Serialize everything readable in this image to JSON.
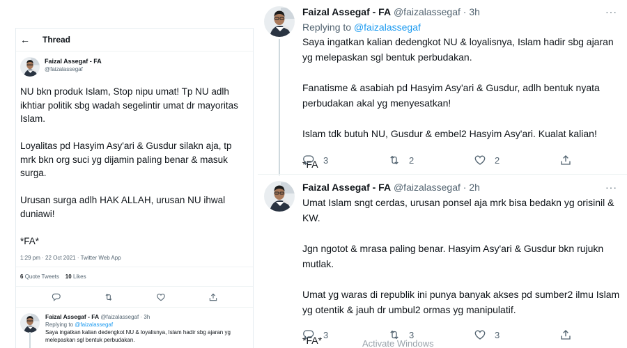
{
  "thread_view": {
    "title": "Thread",
    "main_tweet": {
      "name": "Faizal Assegaf - FA",
      "handle": "@faizalassegaf",
      "paragraphs": [
        "NU bkn produk Islam, Stop nipu umat! Tp NU adlh ikhtiar politik sbg wadah segelintir umat dr mayoritas Islam.",
        "Loyalitas pd Hasyim Asy'ari & Gusdur silakn aja, tp mrk bkn org suci yg dijamin paling benar & masuk surga.",
        "Urusan surga adlh HAK ALLAH, urusan NU ihwal duniawi!",
        "*FA*"
      ],
      "meta": "1:29 pm · 22 Oct 2021 · Twitter Web App",
      "quote_count": "6",
      "quote_label": "Quote Tweets",
      "like_count": "10",
      "like_label": "Likes"
    },
    "reply": {
      "name": "Faizal Assegaf - FA",
      "handle_time": "@faizalassegaf · 3h",
      "replying_prefix": "Replying to",
      "replying_handle": "@faizalassegaf",
      "text": "Saya ingatkan kalian dedengkot NU & loyalisnya, Islam hadir sbg ajaran yg melepaskan sgl bentuk perbudakan."
    }
  },
  "tweets": [
    {
      "name": "Faizal Assegaf - FA",
      "meta": "@faizalassegaf · 3h",
      "replying_prefix": "Replying to",
      "replying_handle": "@faizalassegaf",
      "paragraphs": [
        "Saya ingatkan kalian dedengkot NU & loyalisnya, Islam hadir sbg ajaran yg melepaskan sgl bentuk perbudakan.",
        "Fanatisme & asabiah pd Hasyim Asy'ari & Gusdur, adlh bentuk nyata perbudakan akal yg menyesatkan!",
        "Islam tdk butuh NU, Gusdur & embel2 Hasyim Asy'ari. Kualat kalian!",
        "*FA"
      ],
      "replies": "3",
      "retweets": "2",
      "likes": "2"
    },
    {
      "name": "Faizal Assegaf - FA",
      "meta": "@faizalassegaf · 2h",
      "paragraphs": [
        "Umat Islam sngt cerdas, urusan ponsel aja mrk bisa bedakn yg orisinil & KW.",
        "Jgn ngotot & mrasa paling benar. Hasyim Asy'ari & Gusdur bkn rujukn mutlak.",
        "Umat yg waras di republik ini punya banyak akses pd sumber2 ilmu Islam yg otentik & jauh dr umbul2 ormas yg manipulatif.",
        "*FA*"
      ],
      "replies": "3",
      "retweets": "3",
      "likes": "3"
    }
  ],
  "watermark": "Activate Windows",
  "icons": {
    "back": "back-arrow-icon",
    "more": "more-icon",
    "reply": "reply-icon",
    "retweet": "retweet-icon",
    "like": "like-icon",
    "share": "share-icon"
  },
  "colors": {
    "link": "#1d9bf0",
    "secondary_text": "#536471",
    "primary_text": "#0f1419"
  }
}
